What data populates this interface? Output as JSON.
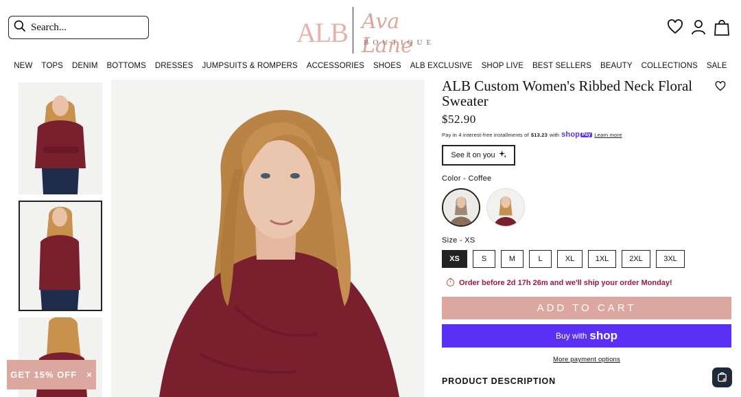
{
  "search": {
    "placeholder": "Search..."
  },
  "logo": {
    "monogram": "ALB",
    "script": "Ava Lane",
    "subtitle": "BOUTIQUE"
  },
  "nav": [
    "NEW",
    "TOPS",
    "DENIM",
    "BOTTOMS",
    "DRESSES",
    "JUMPSUITS & ROMPERS",
    "ACCESSORIES",
    "SHOES",
    "ALB EXCLUSIVE",
    "SHOP LIVE",
    "BEST SELLERS",
    "BEAUTY",
    "COLLECTIONS",
    "SALE"
  ],
  "product": {
    "title": "ALB Custom Women's Ribbed Neck Floral Sweater",
    "price": "$52.90",
    "installments": {
      "prefix": "Pay in 4 interest-free installments of",
      "amount": "$13.23",
      "with": "with",
      "shop": "shop",
      "pay": "Pay",
      "learn_more": "Learn more"
    },
    "see_it_on_you": "See it on you",
    "color_label": "Color - Coffee",
    "size_label": "Size - XS",
    "sizes": [
      "XS",
      "S",
      "M",
      "L",
      "XL",
      "1XL",
      "2XL",
      "3XL"
    ],
    "selected_size": "XS",
    "order_notice": "Order before 2d 17h 26m and we'll ship your order Monday!",
    "add_to_cart": "ADD TO CART",
    "buy_with": "Buy with",
    "buy_shop": "shop",
    "more_payment": "More payment options",
    "description_heading": "PRODUCT DESCRIPTION"
  },
  "promo": {
    "label": "GET 15% OFF",
    "close": "×"
  },
  "colors": {
    "accent": "#dca79f",
    "shop_pay": "#5a31f4",
    "sweater": "#7a1f2e",
    "alert": "#a3163d"
  }
}
